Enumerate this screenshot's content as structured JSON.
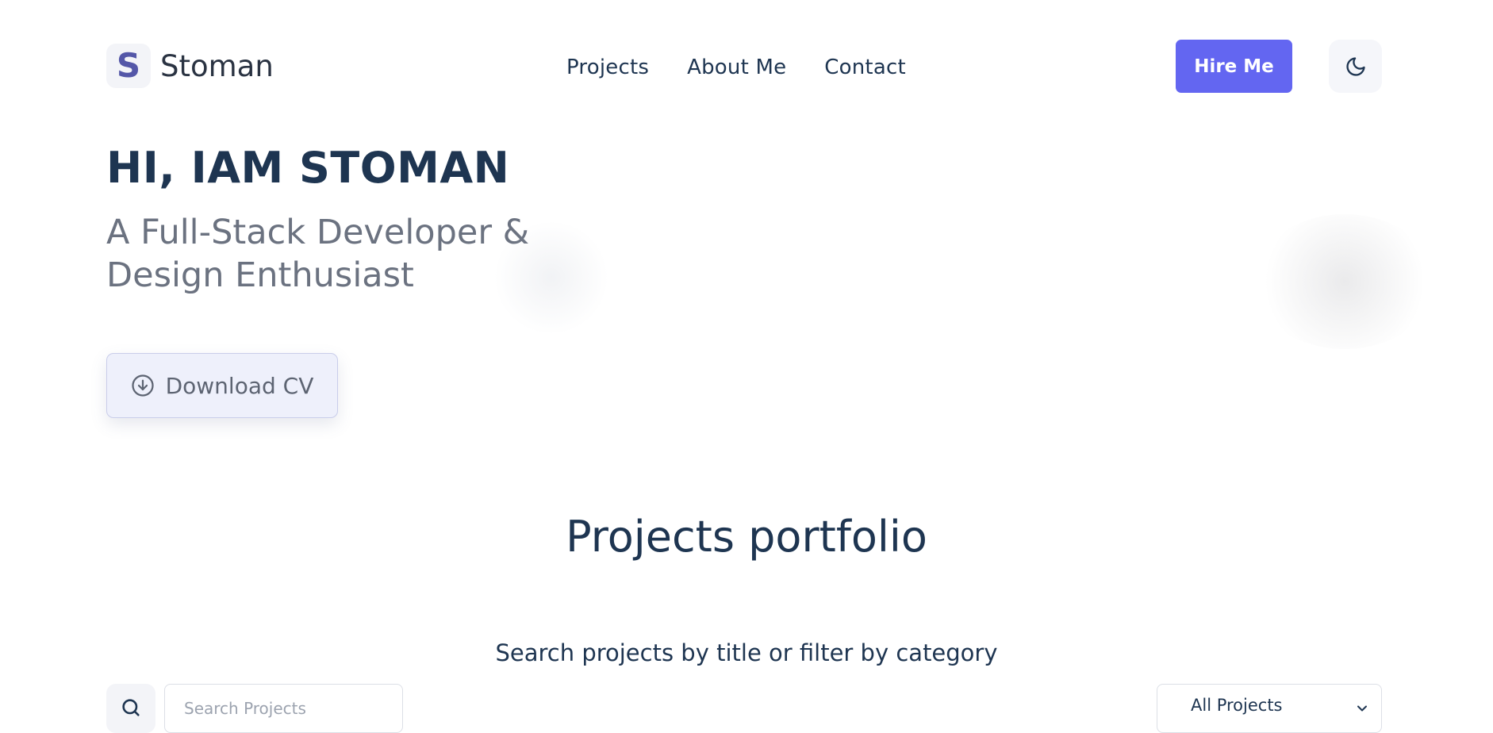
{
  "header": {
    "logo_letter": "S",
    "brand": "Stoman",
    "nav": [
      {
        "label": "Projects"
      },
      {
        "label": "About Me"
      },
      {
        "label": "Contact"
      }
    ],
    "hire_label": "Hire Me",
    "theme_toggle_icon": "moon-icon"
  },
  "hero": {
    "title": "HI, IAM STOMAN",
    "subtitle": "A Full-Stack Developer & Design Enthusiast",
    "download_label": "Download CV",
    "download_icon": "arrow-circle-down-icon"
  },
  "projects": {
    "title": "Projects portfolio",
    "subtitle": "Search projects by title or filter by category",
    "search_placeholder": "Search Projects",
    "search_icon": "search-icon",
    "filter_value": "All Projects"
  },
  "colors": {
    "accent": "#6366f1",
    "heading": "#1e3551",
    "muted": "#6b7280",
    "logo_mark": "#5457a8"
  }
}
